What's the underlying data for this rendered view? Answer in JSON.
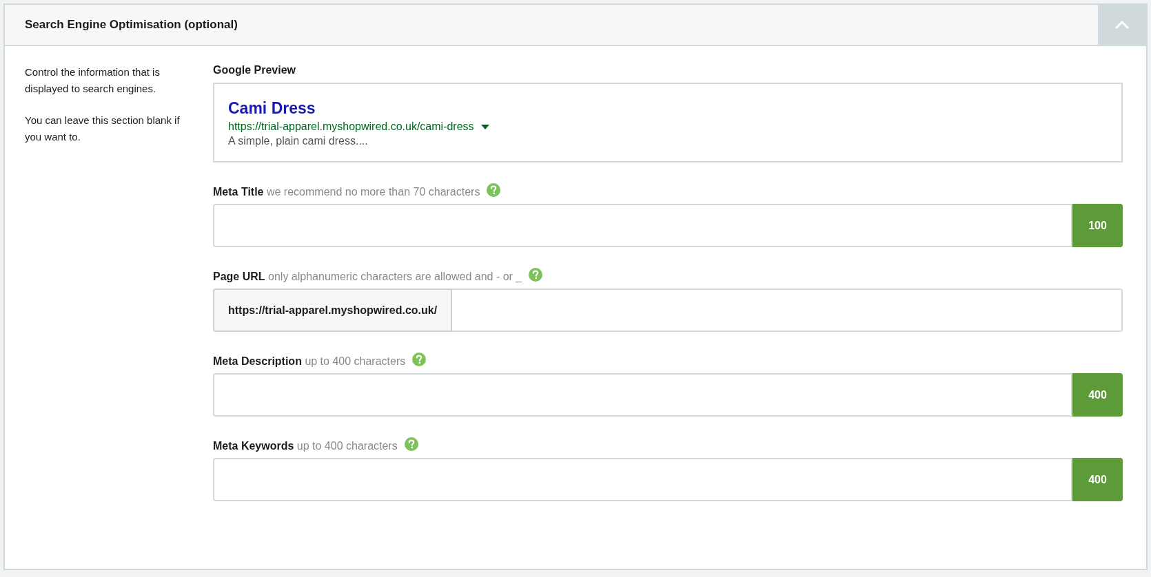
{
  "panel": {
    "title": "Search Engine Optimisation (optional)",
    "expanded": true
  },
  "intro": [
    "Control the information that is displayed to search engines.",
    "You can leave this section blank if you want to."
  ],
  "preview": {
    "label": "Google Preview",
    "title": "Cami Dress",
    "url": "https://trial-apparel.myshopwired.co.uk/cami-dress",
    "description": "A simple, plain cami dress...."
  },
  "fields": [
    {
      "kind": "counter",
      "label": "Meta Title",
      "hint": "we recommend no more than 70 characters",
      "counter": "100"
    },
    {
      "kind": "prefix",
      "label": "Page URL",
      "hint": "only alphanumeric characters are allowed and - or _",
      "prefix": "https://trial-apparel.myshopwired.co.uk/"
    },
    {
      "kind": "counter",
      "label": "Meta Description",
      "hint": "up to 400 characters",
      "counter": "400"
    },
    {
      "kind": "counter",
      "label": "Meta Keywords",
      "hint": "up to 400 characters",
      "counter": "400"
    }
  ]
}
